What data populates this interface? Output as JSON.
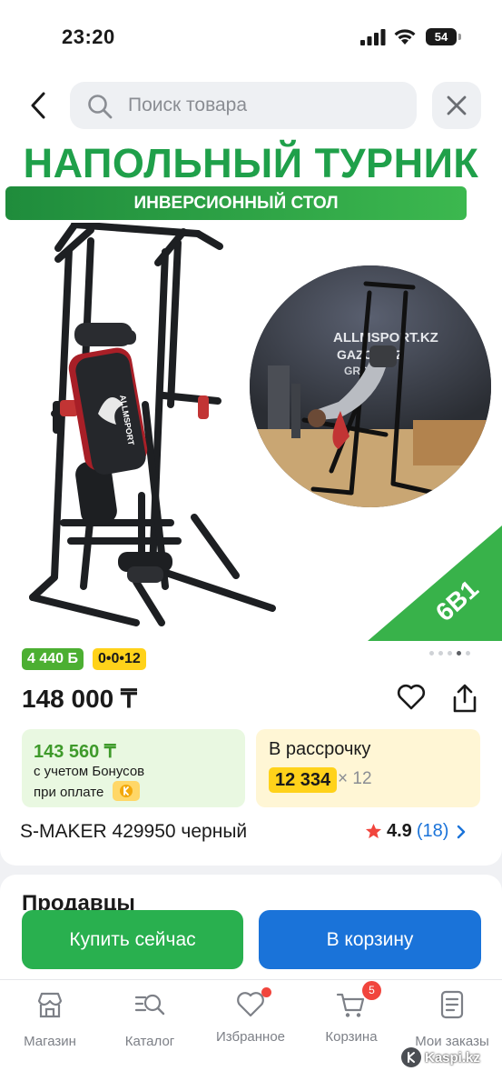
{
  "status_bar": {
    "time": "23:20",
    "battery": "54"
  },
  "search": {
    "placeholder": "Поиск товара"
  },
  "gallery": {
    "promo_title": "НАПОЛЬНЫЙ ТУРНИК",
    "promo_subtitle": "ИНВЕРСИОННЫЙ СТОЛ",
    "photo_sign_lines": [
      "ALLMSPORT.KZ",
      "GAZON.KZ",
      "GROUP"
    ],
    "corner_label": "6В1",
    "equipment_logo": "ALLMSPORT",
    "slides_total": 5,
    "slide_active": 4
  },
  "badges": {
    "bonus": "4 440 Б",
    "credit": "0•0•12"
  },
  "price": "148 000 ₸",
  "bonus_offer": {
    "amount": "143 560 ₸",
    "line1": "с учетом Бонусов",
    "line2": "при оплате"
  },
  "installment": {
    "title": "В рассрочку",
    "monthly": "12 334",
    "months": "× 12"
  },
  "product": {
    "name": "S-MAKER 429950 черный",
    "rating": "4.9",
    "reviews": "(18)"
  },
  "sellers": {
    "heading": "Продавцы"
  },
  "actions": {
    "buy_now": "Купить сейчас",
    "add_to_cart": "В корзину"
  },
  "tabbar": {
    "items": [
      {
        "label": "Магазин",
        "icon": "store-icon"
      },
      {
        "label": "Каталог",
        "icon": "catalog-icon"
      },
      {
        "label": "Избранное",
        "icon": "heart-icon"
      },
      {
        "label": "Корзина",
        "icon": "cart-icon",
        "badge": "5"
      },
      {
        "label": "Мои заказы",
        "icon": "orders-icon"
      }
    ]
  },
  "watermark": "Kaspi.kz",
  "colors": {
    "brand_green": "#29b04f",
    "brand_blue": "#1a73d9",
    "kaspi_red": "#f1453d",
    "credit_yellow": "#ffd21a"
  }
}
